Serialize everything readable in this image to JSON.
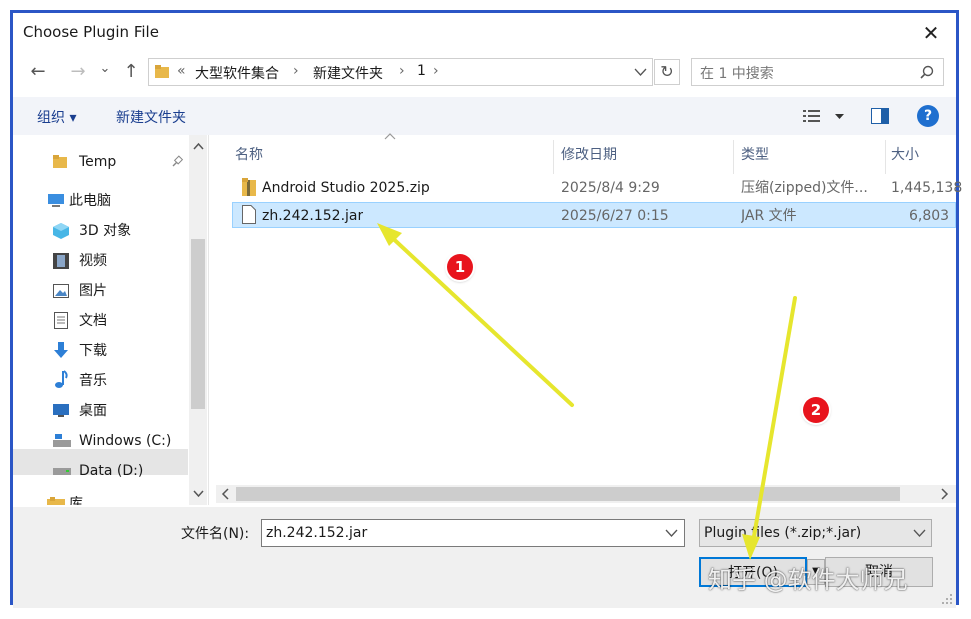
{
  "window": {
    "title": "Choose Plugin File"
  },
  "nav": {
    "back": "←",
    "forward": "→",
    "recent": "⌄",
    "up": "↑",
    "refresh": "↻"
  },
  "address": {
    "chevron": "«",
    "breadcrumbs": [
      "大型软件集合",
      "新建文件夹",
      "1"
    ],
    "sep": "›"
  },
  "search": {
    "placeholder": "在 1 中搜索"
  },
  "toolbar": {
    "organize": "组织 ▾",
    "new_folder": "新建文件夹"
  },
  "sidebar": {
    "items": [
      {
        "label": "Temp",
        "icon": "folder-icon"
      },
      {
        "label": "此电脑",
        "icon": "computer-icon"
      },
      {
        "label": "3D 对象",
        "icon": "cube-icon"
      },
      {
        "label": "视频",
        "icon": "video-icon"
      },
      {
        "label": "图片",
        "icon": "picture-icon"
      },
      {
        "label": "文档",
        "icon": "document-icon"
      },
      {
        "label": "下载",
        "icon": "download-icon"
      },
      {
        "label": "音乐",
        "icon": "music-icon"
      },
      {
        "label": "桌面",
        "icon": "desktop-icon"
      },
      {
        "label": "Windows (C:)",
        "icon": "drive-icon"
      },
      {
        "label": "Data (D:)",
        "icon": "drive-icon"
      },
      {
        "label": "库",
        "icon": "library-icon"
      }
    ]
  },
  "columns": {
    "name": "名称",
    "modified": "修改日期",
    "type": "类型",
    "size": "大小"
  },
  "files": [
    {
      "name": "Android Studio 2025.zip",
      "modified": "2025/8/4 9:29",
      "type": "压缩(zipped)文件...",
      "size": "1,445,138"
    },
    {
      "name": "zh.242.152.jar",
      "modified": "2025/6/27 0:15",
      "type": "JAR 文件",
      "size": "6,803"
    }
  ],
  "bottom": {
    "filename_label": "文件名(N):",
    "filename_value": "zh.242.152.jar",
    "filter": "Plugin files (*.zip;*.jar)",
    "open": "打开(O)",
    "cancel": "取消"
  },
  "annotations": {
    "badge1": "1",
    "badge2": "2"
  },
  "watermark": "知乎 @软件大师兄",
  "colors": {
    "frame": "#2b56c6",
    "selection": "#cce8ff",
    "arrow": "#f5f54a",
    "badge": "#e8141d"
  }
}
